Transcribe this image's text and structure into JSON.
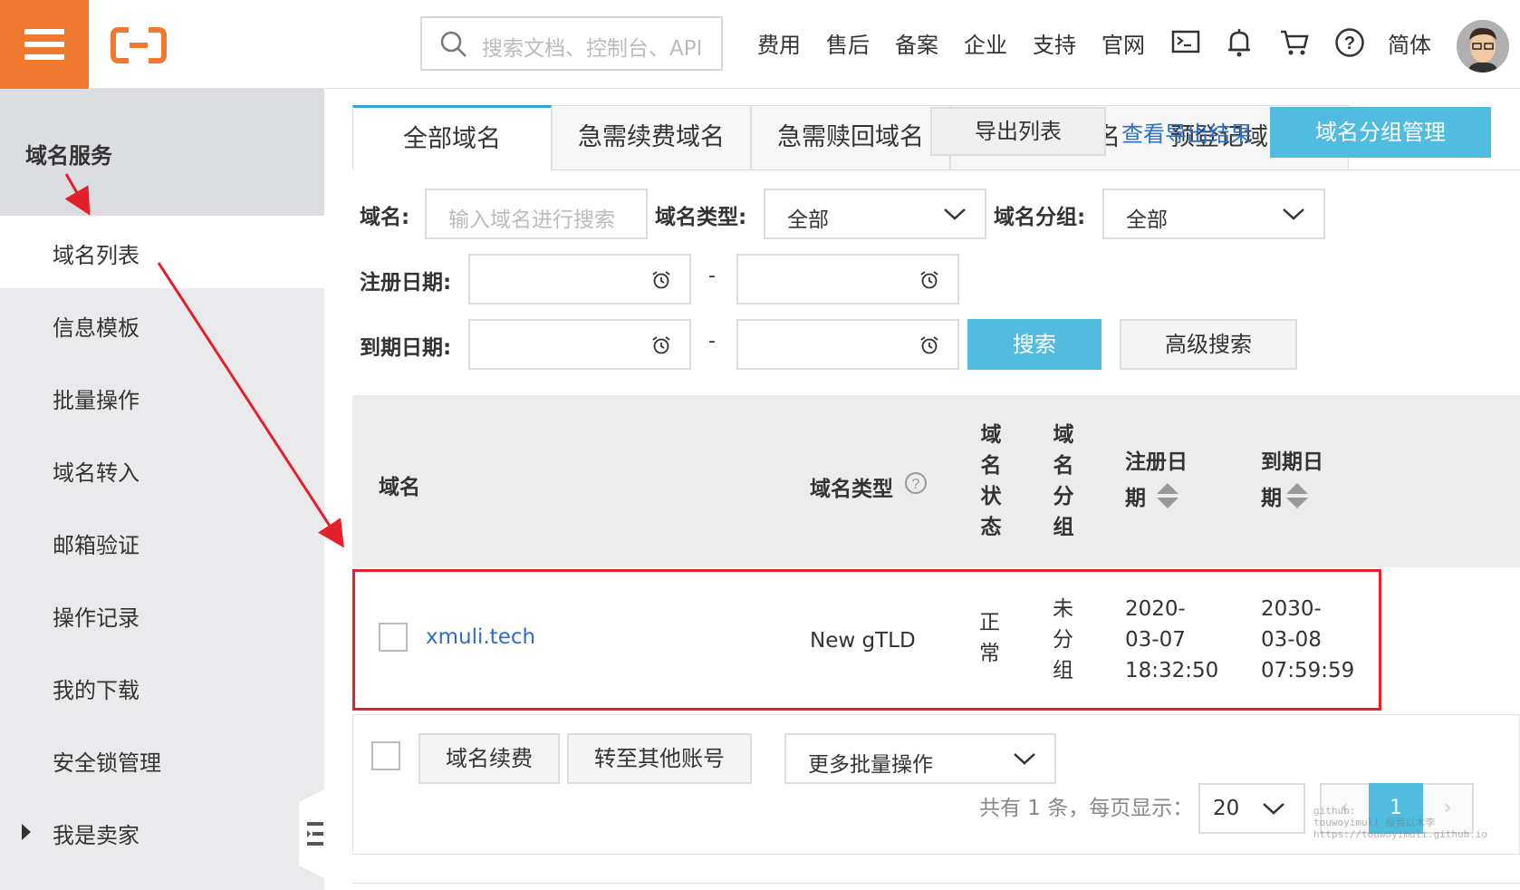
{
  "topbar": {
    "search_placeholder": "搜索文档、控制台、API",
    "nav": [
      "费用",
      "售后",
      "备案",
      "企业",
      "支持",
      "官网"
    ],
    "lang": "简体"
  },
  "sidebar": {
    "title": "域名服务",
    "items": [
      "域名列表",
      "信息模板",
      "批量操作",
      "域名转入",
      "邮箱验证",
      "操作记录",
      "我的下载",
      "安全锁管理",
      "我是卖家"
    ]
  },
  "tabs": [
    "全部域名",
    "急需续费域名",
    "急需赎回域名",
    "名",
    "预登记域"
  ],
  "actions": {
    "export": "导出列表",
    "view_export": "查看导出结果",
    "group_manage": "域名分组管理"
  },
  "filters": {
    "domain_label": "域名:",
    "domain_placeholder": "输入域名进行搜索",
    "type_label": "域名类型:",
    "type_value": "全部",
    "group_label": "域名分组:",
    "group_value": "全部",
    "reg_label": "注册日期:",
    "exp_label": "到期日期:",
    "dash": "-",
    "search": "搜索",
    "advanced": "高级搜索"
  },
  "table": {
    "headers": {
      "domain": "域名",
      "type": "域名类型",
      "status": [
        "域",
        "名",
        "状",
        "态"
      ],
      "group": [
        "域",
        "名",
        "分",
        "组"
      ],
      "reg": [
        "注册日",
        "期"
      ],
      "exp": [
        "到期日",
        "期"
      ]
    },
    "rows": [
      {
        "domain": "xmuli.tech",
        "type": "New gTLD",
        "status": [
          "正",
          "常"
        ],
        "group": [
          "未",
          "分",
          "组"
        ],
        "reg": [
          "2020-",
          "03-07",
          "18:32:50"
        ],
        "exp": [
          "2030-",
          "03-08",
          "07:59:59"
        ]
      }
    ]
  },
  "footer": {
    "renew": "域名续费",
    "transfer": "转至其他账号",
    "more": "更多批量操作",
    "total_text": "共有 1 条，每页显示：",
    "page_size": "20",
    "current_page": "1"
  },
  "watermark": [
    "github:",
    "touwoyimuli",
    "投我以木李",
    "https://touwoyimuli.github.io"
  ]
}
